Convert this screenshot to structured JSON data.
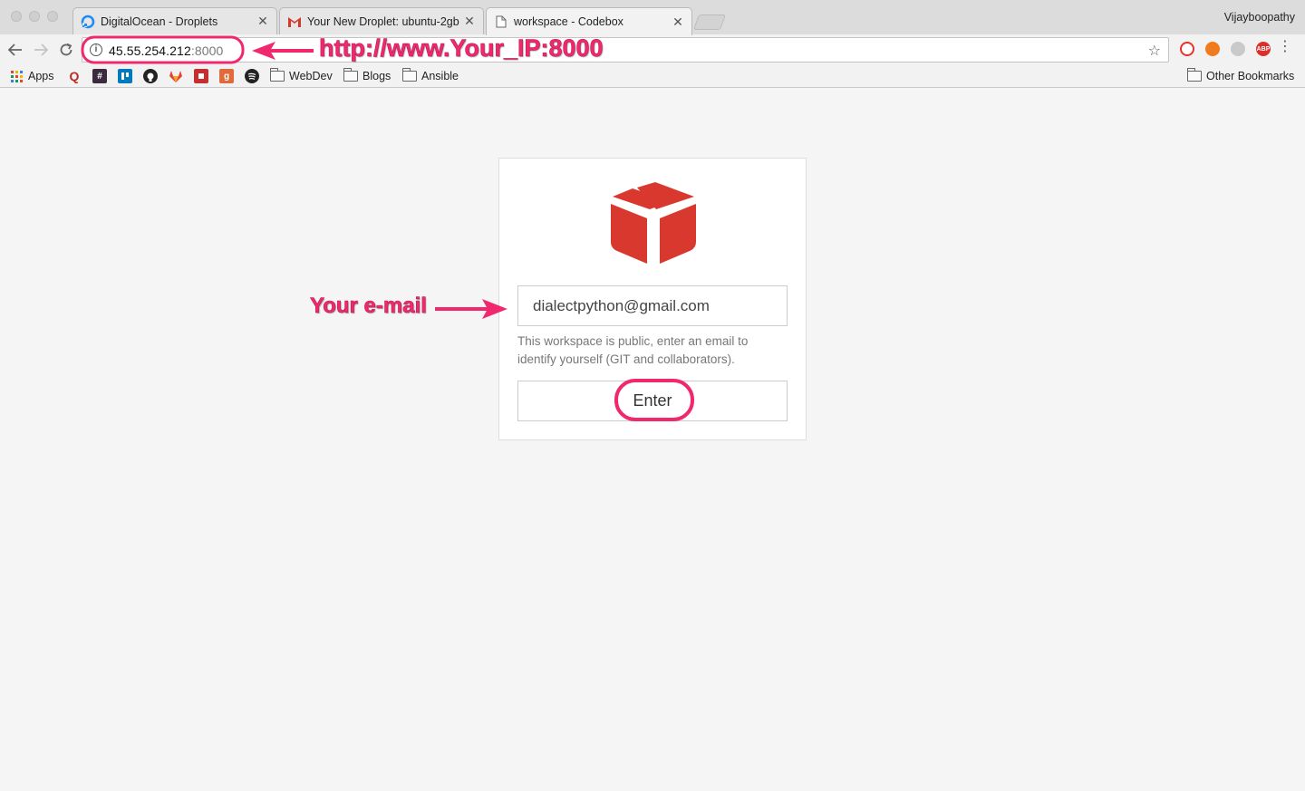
{
  "browser": {
    "profile_name": "Vijayboopathy",
    "tabs": [
      {
        "title": "DigitalOcean - Droplets",
        "icon": "digitalocean-icon",
        "active": false
      },
      {
        "title": "Your New Droplet: ubuntu-2gb",
        "icon": "gmail-icon",
        "active": false
      },
      {
        "title": "workspace - Codebox",
        "icon": "page-icon",
        "active": true
      }
    ],
    "address": {
      "host": "45.55.254.212",
      "port": ":8000"
    },
    "bookmarks": {
      "apps_label": "Apps",
      "folders": [
        "WebDev",
        "Blogs",
        "Ansible"
      ],
      "other_label": "Other Bookmarks"
    }
  },
  "login": {
    "logo_icon": "codebox-box-icon",
    "logo_color": "#d9382f",
    "email_value": "dialectpython@gmail.com",
    "help_text": "This workspace is public, enter an email to identify yourself (GIT and collaborators).",
    "enter_label": "Enter"
  },
  "annotations": {
    "url_callout": "http://www.Your_IP:8000",
    "email_callout": "Your e-mail",
    "color": "#f0296e"
  }
}
